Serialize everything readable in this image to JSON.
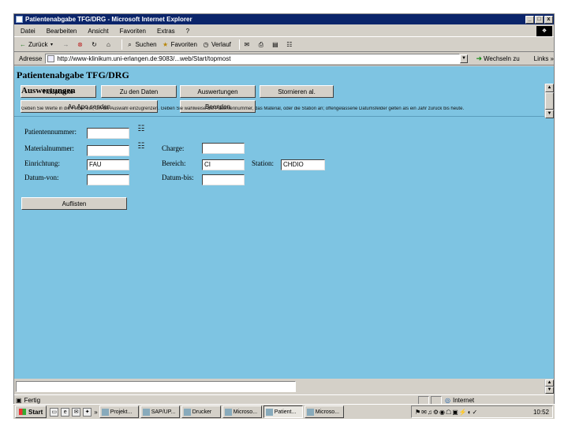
{
  "window": {
    "title": "Patientenabgabe TFG/DRG - Microsoft Internet Explorer",
    "controls": [
      "_",
      "□",
      "x"
    ]
  },
  "menu": {
    "items": [
      "Datei",
      "Bearbeiten",
      "Ansicht",
      "Favoriten",
      "Extras",
      "?"
    ]
  },
  "toolbar": {
    "back_label": "Zurück",
    "search_label": "Suchen",
    "favorites_label": "Favoriten",
    "history_label": "Verlauf"
  },
  "address": {
    "label": "Adresse",
    "url": "http://www-klinikum.uni-erlangen.de:9083/...web/Start/topmost",
    "go_label": "Wechseln zu",
    "links_label": "Links »"
  },
  "app": {
    "title": "Patientenabgabe TFG/DRG",
    "nav_buttons": [
      "Hauptseite",
      "Zu den Daten",
      "Auswertungen",
      "Stornieren al.",
      "An Apo senden",
      "Beenden"
    ]
  },
  "page": {
    "section_title": "Auswertungen",
    "instructions": "Geben Sie Werte in die Felder ein, um die Auswahl einzugrenzen. Geben Sie wahlweise die Patientennummer, das Material, oder die Station an; offengelassene Datumsfelder gelten als ein Jahr zurück bis heute."
  },
  "form": {
    "patient_label": "Patientennummer:",
    "patient_value": "",
    "material_label": "Materialnummer:",
    "material_value": "",
    "charge_label": "Charge:",
    "charge_value": "",
    "einrichtung_label": "Einrichtung:",
    "einrichtung_value": "FAU",
    "bereich_label": "Bereich:",
    "bereich_value": "CI",
    "station_label": "Station:",
    "station_value": "CHDIO",
    "datum_von_label": "Datum-von:",
    "datum_von_value": "",
    "datum_bis_label": "Datum-bis:",
    "datum_bis_value": "",
    "submit_label": "Auflisten"
  },
  "status": {
    "text": "Fertig",
    "zone": "Internet"
  },
  "taskbar": {
    "start_label": "Start",
    "tasks": [
      "Projekt...",
      "SAP/UP...",
      "Drucker",
      "Microso...",
      "Patient...",
      "Microso..."
    ],
    "clock": "10:52"
  }
}
